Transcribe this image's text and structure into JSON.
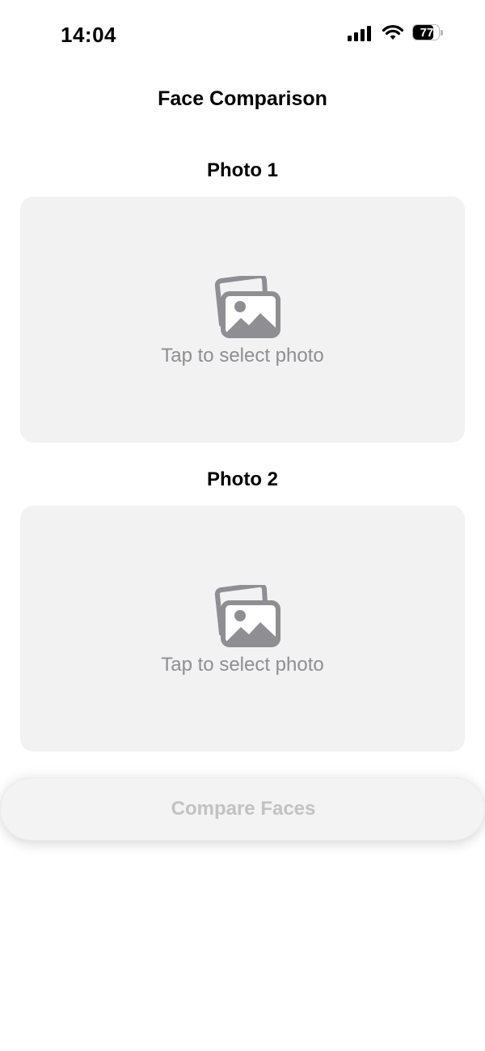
{
  "status_bar": {
    "time": "14:04",
    "battery_level": "77",
    "battery_fraction": 0.77,
    "icons": [
      "signal-icon",
      "wifi-icon",
      "battery-icon"
    ]
  },
  "header": {
    "title": "Face Comparison"
  },
  "photo_slots": [
    {
      "label": "Photo 1",
      "placeholder": "Tap to select photo",
      "icon": "photo-stack-icon"
    },
    {
      "label": "Photo 2",
      "placeholder": "Tap to select photo",
      "icon": "photo-stack-icon"
    }
  ],
  "actions": {
    "compare_label": "Compare Faces",
    "compare_enabled": false
  },
  "colors": {
    "picker_background": "#f2f2f2",
    "placeholder_text": "#8e8e93",
    "icon": "#8e8e93",
    "disabled_button_text": "#c2c2c2"
  }
}
